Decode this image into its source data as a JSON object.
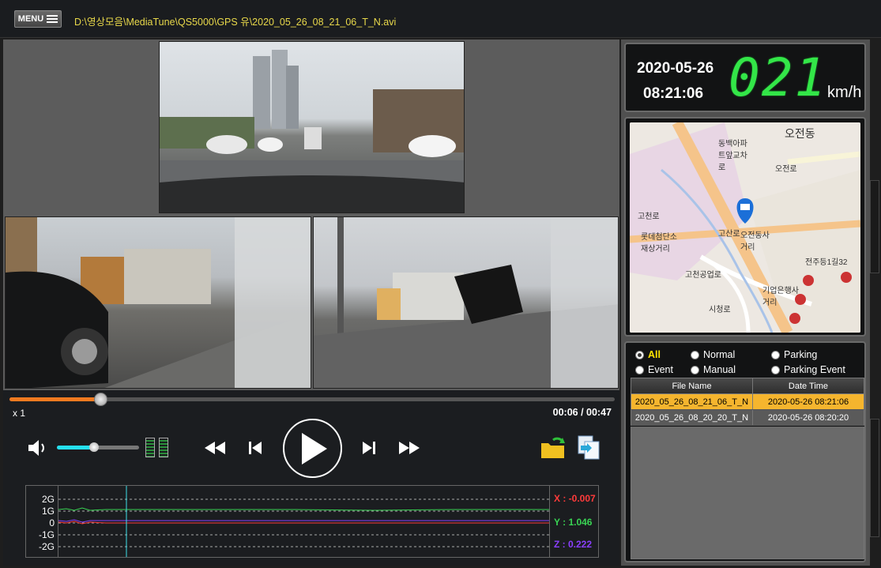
{
  "titlebar": {
    "menu_label": "MENU",
    "file_path": "D:\\영상모음\\MediaTune\\QS5000\\GPS 유\\2020_05_26_08_21_06_T_N.avi"
  },
  "player": {
    "speed": "x 1",
    "timecode": "00:06 / 00:47",
    "progress": 0.15,
    "volume": 0.45
  },
  "gsensor": {
    "y_labels": [
      "2G",
      "1G",
      "0",
      "-1G",
      "-2G"
    ],
    "x_value": "X : -0.007",
    "y_value": "Y : 1.046",
    "z_value": "Z : 0.222",
    "colors": {
      "x": "#ff3b3b",
      "y": "#39d353",
      "z": "#8a3fff"
    }
  },
  "status": {
    "date": "2020-05-26",
    "time": "08:21:06",
    "speed_value": "021",
    "speed_unit": "km/h"
  },
  "map": {
    "labels": [
      "오전동",
      "동백아파트앞교차로",
      "오전로",
      "고산로",
      "오전동사거리",
      "롯데첨단소재상거리",
      "기업은행사거리",
      "고천로",
      "시청로",
      "고천공업로",
      "전주등1길32"
    ]
  },
  "filters": {
    "all": "All",
    "normal": "Normal",
    "parking": "Parking",
    "event": "Event",
    "manual": "Manual",
    "parking_event": "Parking Event"
  },
  "file_table": {
    "headers": [
      "File Name",
      "Date Time"
    ],
    "rows": [
      [
        "2020_05_26_08_21_06_T_N",
        "2020-05-26 08:21:06"
      ],
      [
        "2020_05_26_08_20_20_T_N",
        "2020-05-26 08:20:20"
      ]
    ]
  }
}
